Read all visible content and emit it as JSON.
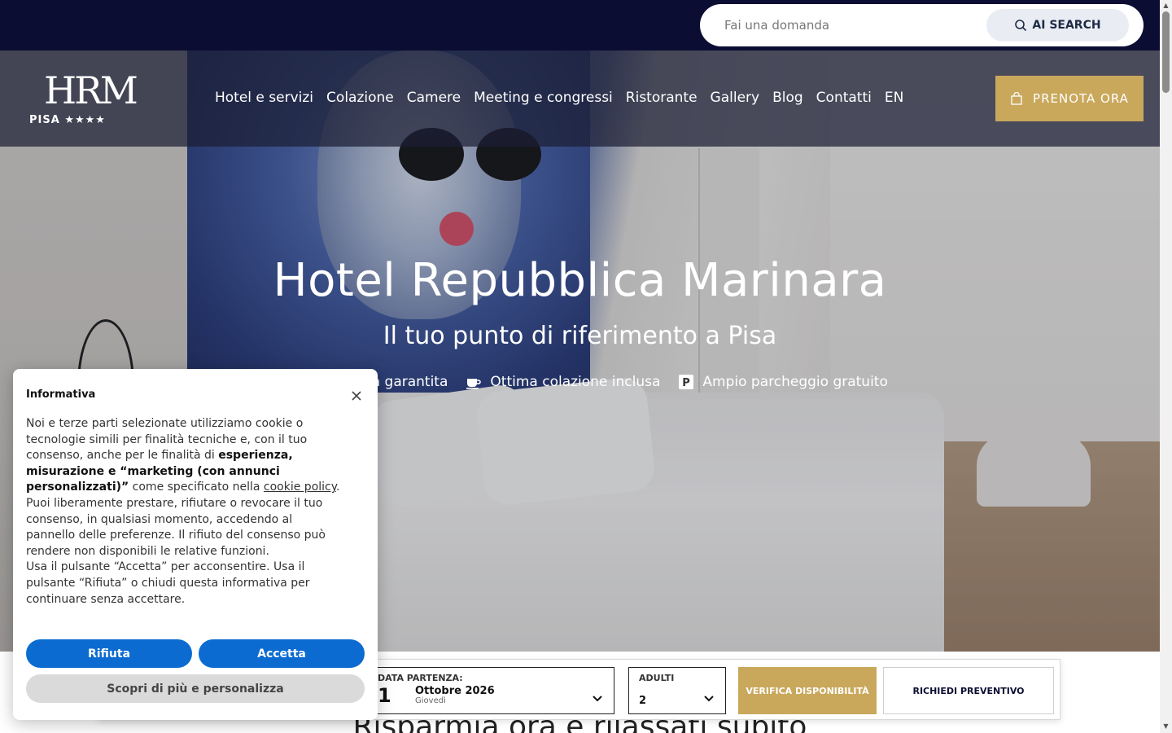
{
  "top_search": {
    "placeholder": "Fai una domanda",
    "button_label": "AI SEARCH"
  },
  "logo": {
    "mark": "HRM",
    "city": "PISA ★★★★"
  },
  "nav": {
    "items": [
      "Hotel e servizi",
      "Colazione",
      "Camere",
      "Meeting e congressi",
      "Ristorante",
      "Gallery",
      "Blog",
      "Contatti",
      "EN"
    ],
    "book_label": "PRENOTA ORA"
  },
  "hero": {
    "title": "Hotel Repubblica Marinara",
    "subtitle": "Il tuo punto di riferimento a Pisa",
    "features": [
      {
        "icon": "check-icon",
        "label": "ffa garantita"
      },
      {
        "icon": "coffee-icon",
        "label": "Ottima colazione inclusa"
      },
      {
        "icon": "parking-icon",
        "label": "Ampio parcheggio gratuito"
      }
    ]
  },
  "below": {
    "title": "Risparmia ora e rilassati subito"
  },
  "booking": {
    "departure_label": "DATA PARTENZA:",
    "departure_day": "1",
    "departure_month": "Ottobre 2026",
    "departure_weekday": "Giovedì",
    "adults_label": "ADULTI",
    "adults_value": "2",
    "verify_label": "VERIFICA DISPONIBILITÀ",
    "quote_label": "RICHIEDI PREVENTIVO"
  },
  "cookie": {
    "title": "Informativa",
    "p1_start": "Noi e terze parti selezionate utilizziamo cookie o tecnologie simili per finalità tecniche e, con il tuo consenso, anche per le finalità di ",
    "p1_bold": "esperienza, misurazione e “marketing (con annunci personalizzati)”",
    "p1_mid": " come specificato nella ",
    "p1_link": "cookie policy",
    "p1_end": ".",
    "p2": "Puoi liberamente prestare, rifiutare o revocare il tuo consenso, in qualsiasi momento, accedendo al pannello delle preferenze. Il rifiuto del consenso può rendere non disponibili le relative funzioni.",
    "p3": "Usa il pulsante “Accetta” per acconsentire. Usa il pulsante “Rifiuta” o chiudi questa informativa per continuare senza accettare.",
    "reject_label": "Rifiuta",
    "accept_label": "Accetta",
    "more_label": "Scopri di più e personalizza"
  },
  "colors": {
    "navy": "#0b0d33",
    "gold": "#c9a85c",
    "cookie_blue": "#0b6bd1"
  }
}
